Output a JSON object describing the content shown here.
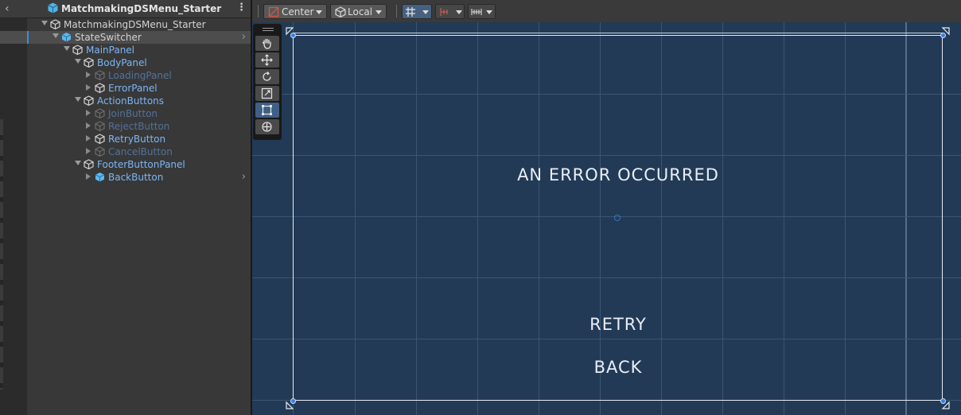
{
  "hierarchy": {
    "header_title": "MatchmakingDSMenu_Starter",
    "items": [
      {
        "label": "MatchmakingDSMenu_Starter",
        "depth": 0
      },
      {
        "label": "StateSwitcher",
        "depth": 1
      },
      {
        "label": "MainPanel",
        "depth": 2
      },
      {
        "label": "BodyPanel",
        "depth": 3
      },
      {
        "label": "LoadingPanel",
        "depth": 4
      },
      {
        "label": "ErrorPanel",
        "depth": 4
      },
      {
        "label": "ActionButtons",
        "depth": 3
      },
      {
        "label": "JoinButton",
        "depth": 4
      },
      {
        "label": "RejectButton",
        "depth": 4
      },
      {
        "label": "RetryButton",
        "depth": 4
      },
      {
        "label": "CancelButton",
        "depth": 4
      },
      {
        "label": "FooterButtonPanel",
        "depth": 3
      },
      {
        "label": "BackButton",
        "depth": 4
      }
    ]
  },
  "toolbar": {
    "pivot_label": "Center",
    "rotation_label": "Local"
  },
  "scene": {
    "error_text": "AN ERROR OCCURRED",
    "retry_label": "RETRY",
    "back_label": "BACK"
  },
  "icons": {
    "scene": "unity-scene-icon",
    "gameobject": "cube-icon",
    "prefab": "prefab-cube-icon"
  },
  "colors": {
    "viewport_bg": "#223a55",
    "selection_accent": "#3d8dd9",
    "prefab_blue": "#7cb5f4"
  }
}
